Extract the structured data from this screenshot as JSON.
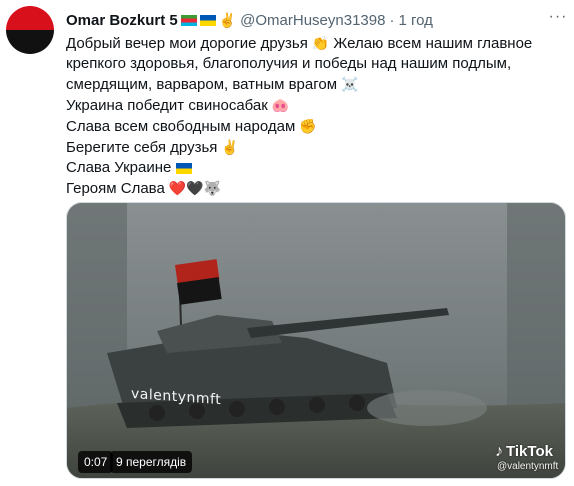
{
  "author": {
    "display_name": "Omar Bozkurt 5",
    "handle": "@OmarHuseyn31398",
    "separator": "·",
    "time": "1 год",
    "victory_emoji": "✌️"
  },
  "more_label": "···",
  "tweet": {
    "lines": [
      {
        "text": "Добрый вечер мои дорогие друзья",
        "emoji": "👏",
        "after": " Желаю всем нашим главное"
      },
      {
        "text": "крепкого здоровья, благополучия и победы над нашим подлым,"
      },
      {
        "text": "смердящим, варваром, ватным врагом",
        "emoji": "☠️"
      },
      {
        "text": "Украина победит свиносабак",
        "emoji": "🐽"
      },
      {
        "text": "Слава всем свободным народам",
        "emoji": "✊"
      },
      {
        "text": "Берегите себя друзья",
        "emoji": "✌️"
      },
      {
        "text": "Слава Украине"
      },
      {
        "text": "Героям Слава",
        "emoji": "❤️🖤🐺"
      }
    ]
  },
  "media": {
    "duration": "0:07",
    "views": "9 переглядів",
    "watermark_brand": "TikTok",
    "watermark_user": "@valentynmft",
    "tank_text": "valentynmft",
    "colors": {
      "sky": "#7b8384",
      "ground": "#595f56",
      "tank": "#3e4444",
      "flag_red": "#b0241c",
      "flag_black": "#151515"
    }
  }
}
